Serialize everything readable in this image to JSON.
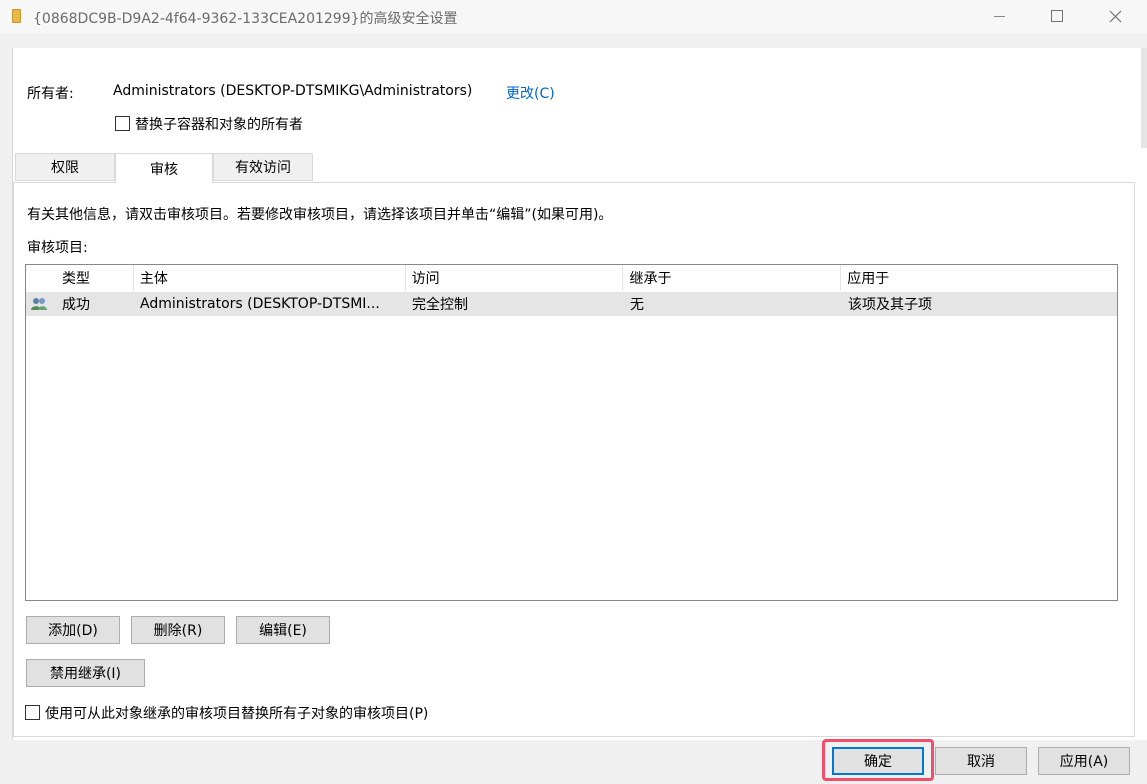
{
  "window": {
    "title": "{0868DC9B-D9A2-4f64-9362-133CEA201299}的高级安全设置"
  },
  "owner": {
    "label": "所有者:",
    "value": "Administrators (DESKTOP-DTSMIKG\\Administrators)",
    "change_link": "更改(C)",
    "replace_checkbox_label": "替换子容器和对象的所有者",
    "replace_checked": false
  },
  "tabs": [
    {
      "label": "权限",
      "active": false
    },
    {
      "label": "审核",
      "active": true
    },
    {
      "label": "有效访问",
      "active": false
    }
  ],
  "audit": {
    "info_text": "有关其他信息，请双击审核项目。若要修改审核项目，请选择该项目并单击“编辑”(如果可用)。",
    "list_label": "审核项目:",
    "columns": [
      "类型",
      "主体",
      "访问",
      "继承于",
      "应用于"
    ],
    "rows": [
      {
        "type": "成功",
        "principal": "Administrators (DESKTOP-DTSMI...",
        "access": "完全控制",
        "inherited_from": "无",
        "applies_to": "该项及其子项",
        "icon": "users-icon"
      }
    ],
    "buttons": {
      "add": "添加(D)",
      "remove": "删除(R)",
      "edit": "编辑(E)",
      "disable_inheritance": "禁用继承(I)"
    },
    "replace_child_checkbox_label": "使用可从此对象继承的审核项目替换所有子对象的审核项目(P)",
    "replace_child_checked": false
  },
  "footer": {
    "ok": "确定",
    "cancel": "取消",
    "apply": "应用(A)"
  },
  "colors": {
    "link": "#0066cc",
    "highlight": "#f24d6a",
    "default_button_border": "#0078d7",
    "selected_row": "#e5e5e5"
  }
}
